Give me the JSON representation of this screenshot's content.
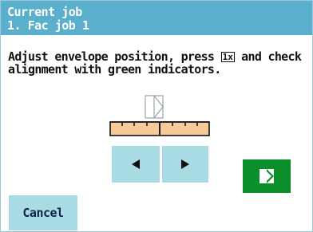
{
  "header": {
    "title": "Current job",
    "job": "1. Fac job 1"
  },
  "instruction": {
    "part1": "Adjust envelope position, press ",
    "key_label": "1x",
    "part2": " and check",
    "line2": "alignment with green indicators."
  },
  "buttons": {
    "cancel_label": "Cancel"
  },
  "icons": {
    "envelope": "envelope-position-icon",
    "ruler": "ruler-icon",
    "left": "arrow-left-icon",
    "right": "arrow-right-icon",
    "go": "envelope-feed-icon"
  },
  "colors": {
    "header": "#5ab0cc",
    "button": "#a9dbe4",
    "go_button": "#0a8f2a",
    "ruler": "#f5c99a"
  }
}
